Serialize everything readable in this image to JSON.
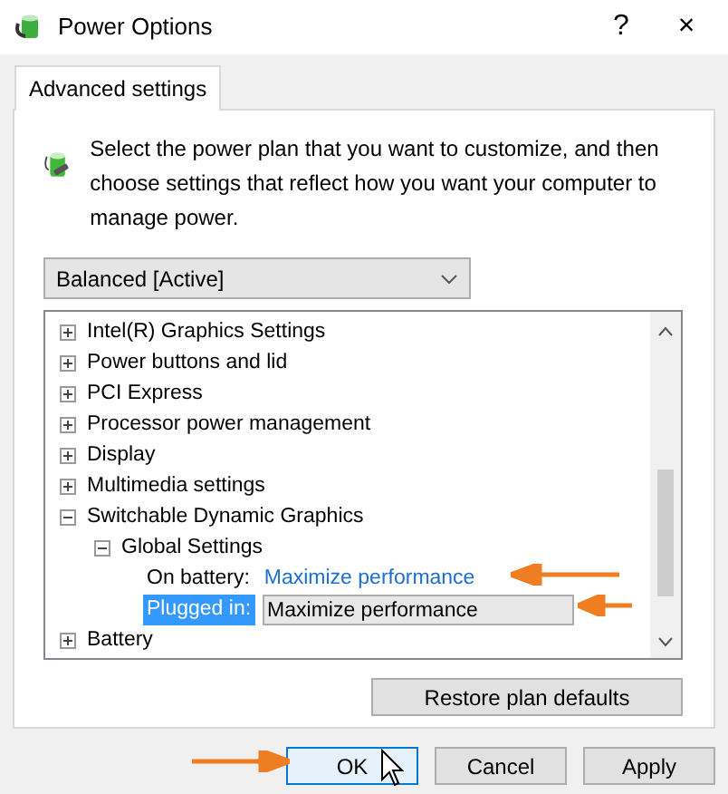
{
  "window": {
    "title": "Power Options",
    "help": "?",
    "close": "×"
  },
  "tabs": [
    {
      "label": "Advanced settings",
      "selected": true
    }
  ],
  "intro": "Select the power plan that you want to customize, and then choose settings that reflect how you want your computer to manage power.",
  "plan_dropdown": {
    "value": "Balanced [Active]"
  },
  "tree": [
    {
      "label": "Intel(R) Graphics Settings",
      "expanded": false
    },
    {
      "label": "Power buttons and lid",
      "expanded": false
    },
    {
      "label": "PCI Express",
      "expanded": false
    },
    {
      "label": "Processor power management",
      "expanded": false
    },
    {
      "label": "Display",
      "expanded": false
    },
    {
      "label": "Multimedia settings",
      "expanded": false
    },
    {
      "label": "Switchable Dynamic Graphics",
      "expanded": true,
      "children": [
        {
          "label": "Global Settings",
          "expanded": true,
          "children": [
            {
              "kind": "setting",
              "label": "On battery:",
              "value": "Maximize performance",
              "selected": false
            },
            {
              "kind": "setting",
              "label": "Plugged in:",
              "value": "Maximize performance",
              "selected": true
            }
          ]
        }
      ]
    },
    {
      "label": "Battery",
      "expanded": false
    }
  ],
  "restore_button": "Restore plan defaults",
  "buttons": [
    {
      "label": "OK",
      "focused": true
    },
    {
      "label": "Cancel",
      "focused": false
    },
    {
      "label": "Apply",
      "focused": false
    }
  ]
}
